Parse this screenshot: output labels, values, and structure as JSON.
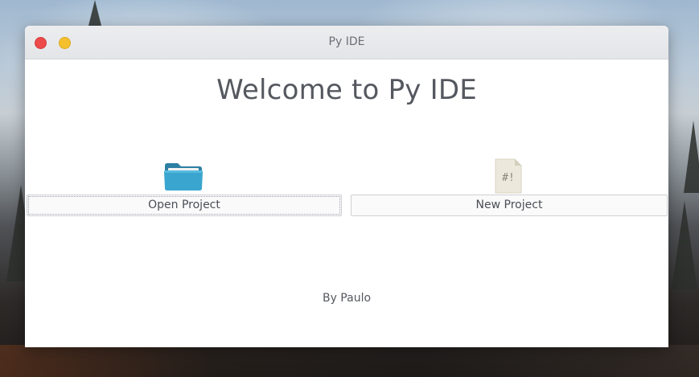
{
  "window": {
    "title": "Py IDE",
    "controls": {
      "close_color": "#ed4a4a",
      "minimize_color": "#f5c02e"
    }
  },
  "main": {
    "heading": "Welcome to Py IDE",
    "actions": [
      {
        "label": "Open Project",
        "icon": "folder-icon"
      },
      {
        "label": "New Project",
        "icon": "script-file-icon",
        "icon_text": "#!"
      }
    ],
    "footer": "By Paulo"
  },
  "colors": {
    "folder": "#3aa6cf",
    "text": "#55585f"
  }
}
